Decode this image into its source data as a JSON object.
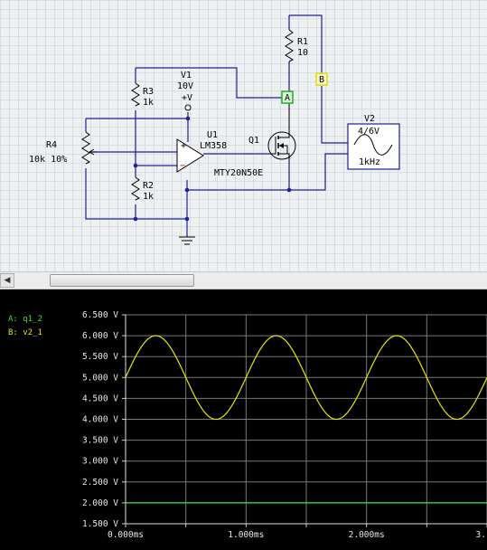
{
  "schematic": {
    "components": {
      "v1": {
        "name": "V1",
        "value": "10V",
        "terminal": "+V"
      },
      "r1": {
        "name": "R1",
        "value": "10"
      },
      "r2": {
        "name": "R2",
        "value": "1k"
      },
      "r3": {
        "name": "R3",
        "value": "1k"
      },
      "r4": {
        "name": "R4",
        "value": "10k 10%"
      },
      "u1": {
        "name": "U1",
        "part": "LM358",
        "plus": "+",
        "minus": "−"
      },
      "q1": {
        "name": "Q1",
        "part": "MTY20N50E"
      },
      "v2": {
        "name": "V2",
        "value": "4/6V",
        "freq": "1kHz"
      }
    },
    "probes": {
      "a": "A",
      "b": "B"
    }
  },
  "grapher": {
    "legend": [
      {
        "label": "A: q1_2",
        "color": "#39e639"
      },
      {
        "label": "B: v2_1",
        "color": "#e6e600"
      }
    ],
    "y_ticks": [
      "6.500 V",
      "6.000 V",
      "5.500 V",
      "5.000 V",
      "4.500 V",
      "4.000 V",
      "3.500 V",
      "3.000 V",
      "2.500 V",
      "2.000 V",
      "1.500 V"
    ],
    "x_ticks": [
      "0.000ms",
      "1.000ms",
      "2.000ms",
      "3."
    ]
  },
  "chart_data": {
    "type": "line",
    "title": "",
    "xlabel": "",
    "ylabel": "",
    "x_unit": "ms",
    "y_unit": "V",
    "xlim": [
      0,
      3.0
    ],
    "ylim": [
      1.5,
      6.5
    ],
    "grid": true,
    "legend_placement": "left",
    "series": [
      {
        "name": "q1_2",
        "color": "#39e639",
        "kind": "constant",
        "value": 2.0
      },
      {
        "name": "v2_1",
        "color": "#e6e600",
        "kind": "sine",
        "offset": 5.0,
        "amplitude": 1.0,
        "frequency_khz": 1.0,
        "phase_deg": 0
      }
    ]
  }
}
